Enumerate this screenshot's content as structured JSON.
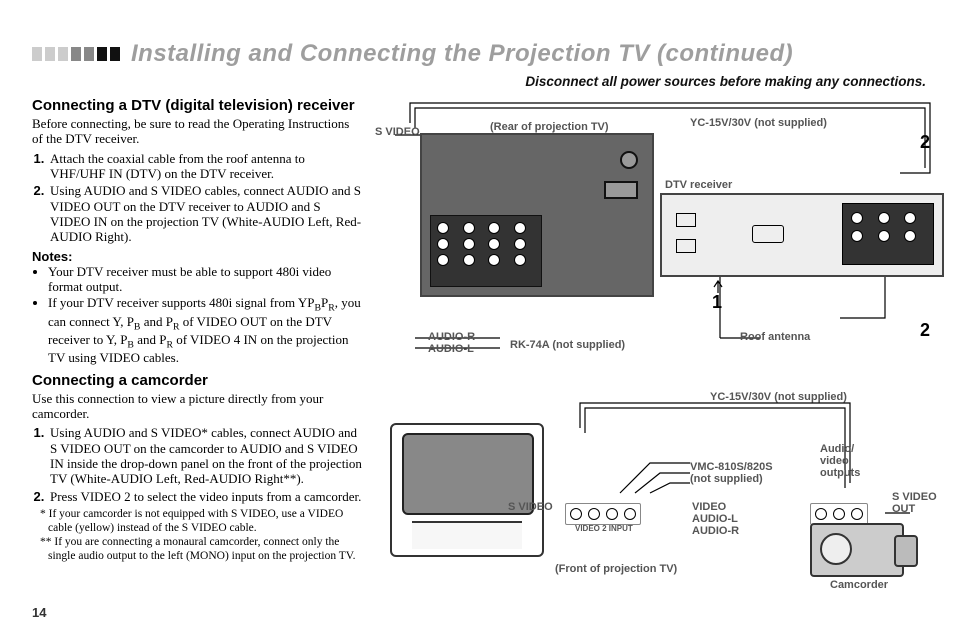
{
  "title": "Installing and Connecting the Projection TV (continued)",
  "warning": "Disconnect all power sources before making any connections.",
  "page_number": "14",
  "section1": {
    "heading": "Connecting a DTV (digital television) receiver",
    "intro": "Before connecting, be sure to read the Operating Instructions of the DTV receiver.",
    "step1": "Attach the coaxial cable from the roof antenna to VHF/UHF IN (DTV) on the DTV receiver.",
    "step2": "Using AUDIO and S VIDEO cables, connect AUDIO and S VIDEO OUT on the DTV receiver to AUDIO and S VIDEO IN on the projection TV (White-AUDIO Left, Red-AUDIO Right).",
    "notes_h": "Notes:",
    "note1": "Your DTV receiver must be able to support 480i video format output.",
    "note2_a": "If your DTV receiver supports 480i signal from YP",
    "note2_b": ", you can connect Y, P",
    "note2_c": " and P",
    "note2_d": " of VIDEO OUT on the DTV receiver to Y, P",
    "note2_e": " and P",
    "note2_f": " of VIDEO 4 IN on the projection TV using VIDEO cables.",
    "sub_b": "B",
    "sub_pr": "R"
  },
  "section2": {
    "heading": "Connecting a camcorder",
    "intro": "Use this connection to view a picture directly from your camcorder.",
    "step1": "Using AUDIO and S VIDEO* cables, connect AUDIO and S VIDEO OUT on the camcorder to AUDIO and S VIDEO IN inside the drop-down panel on the front of the projection TV (White-AUDIO Left, Red-AUDIO Right**).",
    "step2": "Press VIDEO 2 to select the video inputs from a camcorder.",
    "footnote1": "* If your camcorder is not equipped with S VIDEO, use a VIDEO cable (yellow) instead of the S VIDEO cable.",
    "footnote2": "** If you are connecting a monaural camcorder, connect only the single audio output to the left (MONO) input on the projection TV."
  },
  "diagram1": {
    "svideo": "S VIDEO",
    "rear_label": "(Rear of projection TV)",
    "yc": "YC-15V/30V (not supplied)",
    "dtv": "DTV receiver",
    "callout1": "1",
    "callout2": "2",
    "audio_r": "AUDIO-R",
    "audio_l": "AUDIO-L",
    "rk": "RK-74A (not supplied)",
    "roof": "Roof antenna"
  },
  "diagram2": {
    "yc": "YC-15V/30V (not supplied)",
    "svideo_l": "S VIDEO",
    "vmc": "VMC-810S/820S\n(not supplied)",
    "av_out": "Audio/\nvideo\noutputs",
    "svideo_out": "S VIDEO\nOUT",
    "stack": "VIDEO\nAUDIO-L\nAUDIO-R",
    "front_label": "(Front of projection TV)",
    "camcorder": "Camcorder",
    "video2": "VIDEO 2 INPUT"
  }
}
